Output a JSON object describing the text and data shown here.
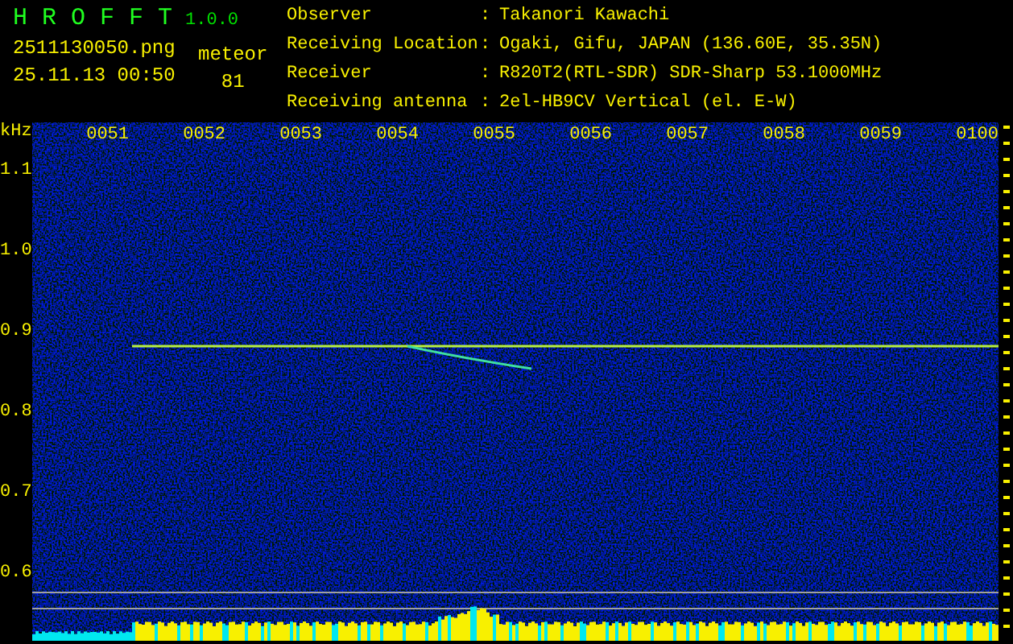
{
  "app": {
    "name": "H R O F F T",
    "version": "1.0.0"
  },
  "file": {
    "name": "2511130050.png",
    "datetime": "25.11.13 00:50"
  },
  "detection": {
    "label": "meteor",
    "count": "81"
  },
  "station": [
    {
      "label": "Observer",
      "separator": ":",
      "value": "Takanori Kawachi"
    },
    {
      "label": "Receiving Location",
      "separator": ":",
      "value": "Ogaki, Gifu, JAPAN (136.60E, 35.35N)"
    },
    {
      "label": "Receiver",
      "separator": ":",
      "value": "R820T2(RTL-SDR) SDR-Sharp 53.1000MHz"
    },
    {
      "label": "Receiving antenna",
      "separator": ":",
      "value": "2el-HB9CV Vertical (el. E-W)"
    }
  ],
  "axis": {
    "unit": "kHz",
    "time_labels": [
      "0051",
      "0052",
      "0053",
      "0054",
      "0055",
      "0056",
      "0057",
      "0058",
      "0059",
      "0100"
    ],
    "freq_labels": [
      "1.1",
      "1.0",
      "0.9",
      "0.8",
      "0.7",
      "0.6"
    ]
  }
}
